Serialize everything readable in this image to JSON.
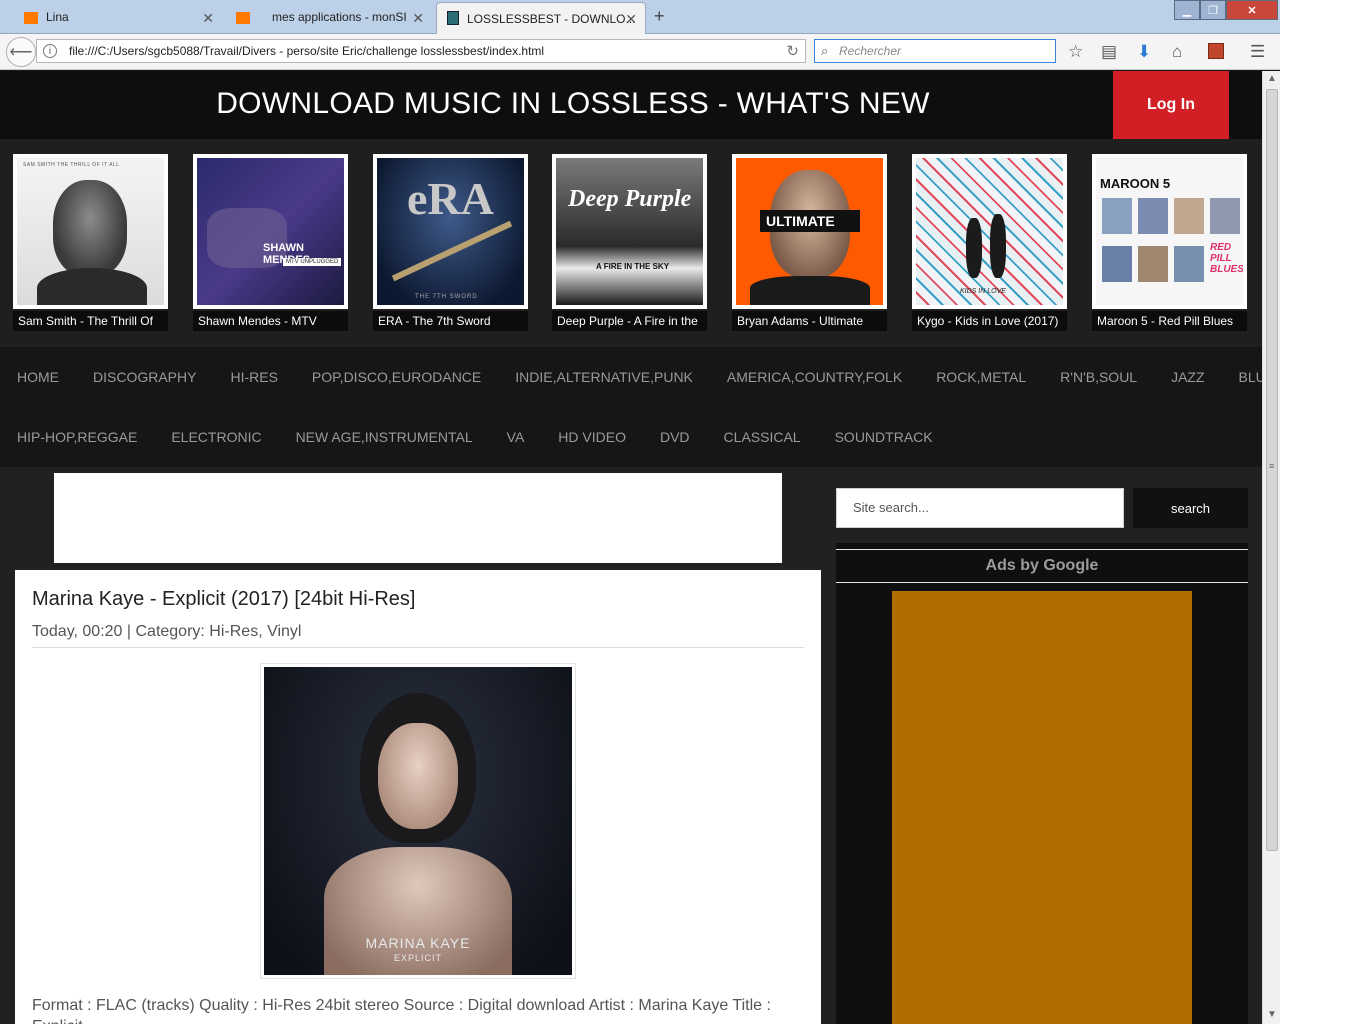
{
  "browser": {
    "tabs": [
      {
        "label": "Lina"
      },
      {
        "label": "mes applications - monSI"
      },
      {
        "label": "LOSSLESSBEST - DOWNLO..."
      }
    ],
    "new_tab_icon": "+",
    "url": "file:///C:/Users/sgcb5088/Travail/Divers - perso/site Eric/challenge losslessbest/index.html",
    "search_placeholder": "Rechercher",
    "colors": {
      "orange_favicon": "#ff7900",
      "close_button": "#c9463b"
    }
  },
  "header": {
    "title": "DOWNLOAD MUSIC IN LOSSLESS - WHAT'S NEW",
    "login_label": "Log In",
    "accent": "#d21e25"
  },
  "carousel": [
    {
      "caption": "Sam Smith - The Thrill Of",
      "art_text": "SAM SMITH     THE THRILL OF IT ALL"
    },
    {
      "caption": "Shawn Mendes - MTV",
      "art_text": "SHAWN MENDES",
      "art_sub": "MTV UNPLUGGED"
    },
    {
      "caption": "ERA - The 7th Sword",
      "art_text": "eRA",
      "art_sub": "THE 7TH SWORD"
    },
    {
      "caption": "Deep Purple - A Fire in the",
      "art_text": "Deep Purple",
      "art_sub": "A FIRE IN THE SKY"
    },
    {
      "caption": "Bryan Adams - Ultimate",
      "art_text": "ULTIMATE"
    },
    {
      "caption": "Kygo - Kids in Love (2017)",
      "art_text": "KIDS IN LOVE"
    },
    {
      "caption": "Maroon 5 - Red Pill Blues",
      "art_text": "MAROON 5",
      "art_sub": "RED PILL BLUES"
    }
  ],
  "menu": {
    "row1": [
      "HOME",
      "DISCOGRAPHY",
      "HI-RES",
      "POP,DISCO,EURODANCE",
      "INDIE,ALTERNATIVE,PUNK",
      "AMERICA,COUNTRY,FOLK",
      "ROCK,METAL",
      "R'N'B,SOUL",
      "JAZZ",
      "BLUES"
    ],
    "row2": [
      "HIP-HOP,REGGAE",
      "ELECTRONIC",
      "NEW AGE,INSTRUMENTAL",
      "VA",
      "HD VIDEO",
      "DVD",
      "CLASSICAL",
      "SOUNDTRACK"
    ]
  },
  "article": {
    "title": "Marina Kaye - Explicit (2017) [24bit Hi-Res]",
    "meta": "Today, 00:20 | Category: Hi-Res, Vinyl",
    "cover_artist": "MARINA KAYE",
    "cover_title": "EXPLICIT",
    "body": "Format : FLAC (tracks) Quality : Hi-Res 24bit stereo Source : Digital download Artist : Marina Kaye Title : Explicit"
  },
  "sidebar": {
    "search_placeholder": "Site search...",
    "search_button": "search",
    "ads_title": "Ads by Google",
    "ads_color": "#b06e00"
  }
}
